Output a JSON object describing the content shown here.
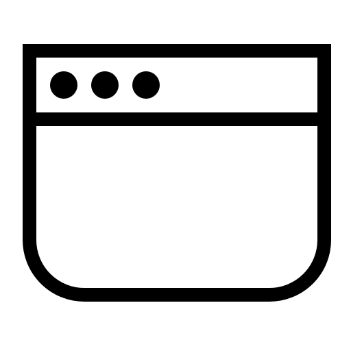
{
  "icon": {
    "name": "browser-window-icon",
    "stroke_color": "#000000",
    "fill_color": "#ffffff",
    "title_bar_dots": [
      "window-dot-1",
      "window-dot-2",
      "window-dot-3"
    ]
  }
}
